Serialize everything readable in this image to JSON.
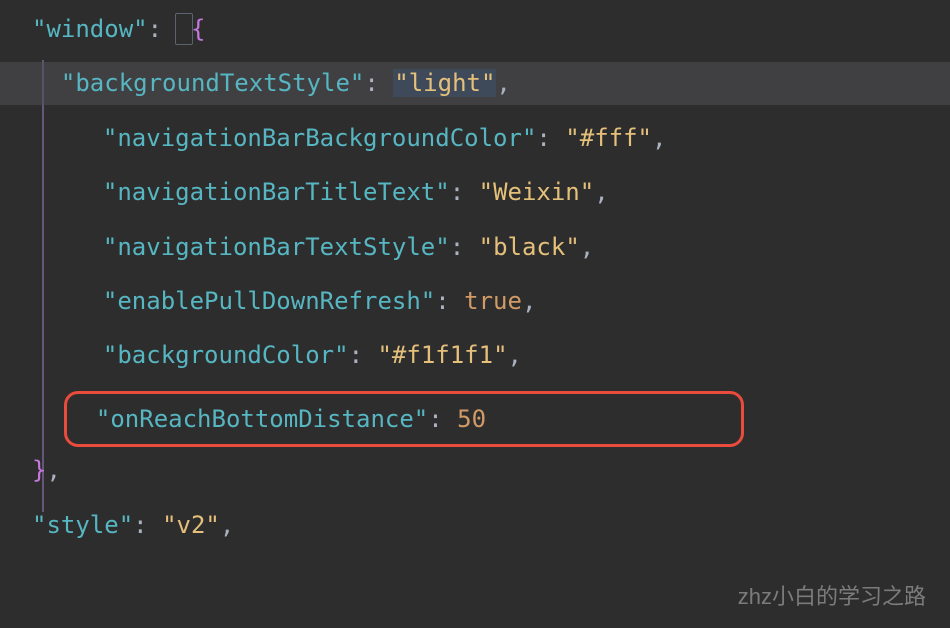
{
  "code": {
    "rootKey": "window",
    "properties": {
      "backgroundTextStyle": {
        "key": "backgroundTextStyle",
        "value": "light",
        "type": "string"
      },
      "navigationBarBackgroundColor": {
        "key": "navigationBarBackgroundColor",
        "value": "#fff",
        "type": "string"
      },
      "navigationBarTitleText": {
        "key": "navigationBarTitleText",
        "value": "Weixin",
        "type": "string"
      },
      "navigationBarTextStyle": {
        "key": "navigationBarTextStyle",
        "value": "black",
        "type": "string"
      },
      "enablePullDownRefresh": {
        "key": "enablePullDownRefresh",
        "value": "true",
        "type": "boolean"
      },
      "backgroundColor": {
        "key": "backgroundColor",
        "value": "#f1f1f1",
        "type": "string"
      },
      "onReachBottomDistance": {
        "key": "onReachBottomDistance",
        "value": "50",
        "type": "number"
      }
    },
    "nextKey": "style",
    "nextValue": "v2"
  },
  "watermark": "zhz小白的学习之路"
}
